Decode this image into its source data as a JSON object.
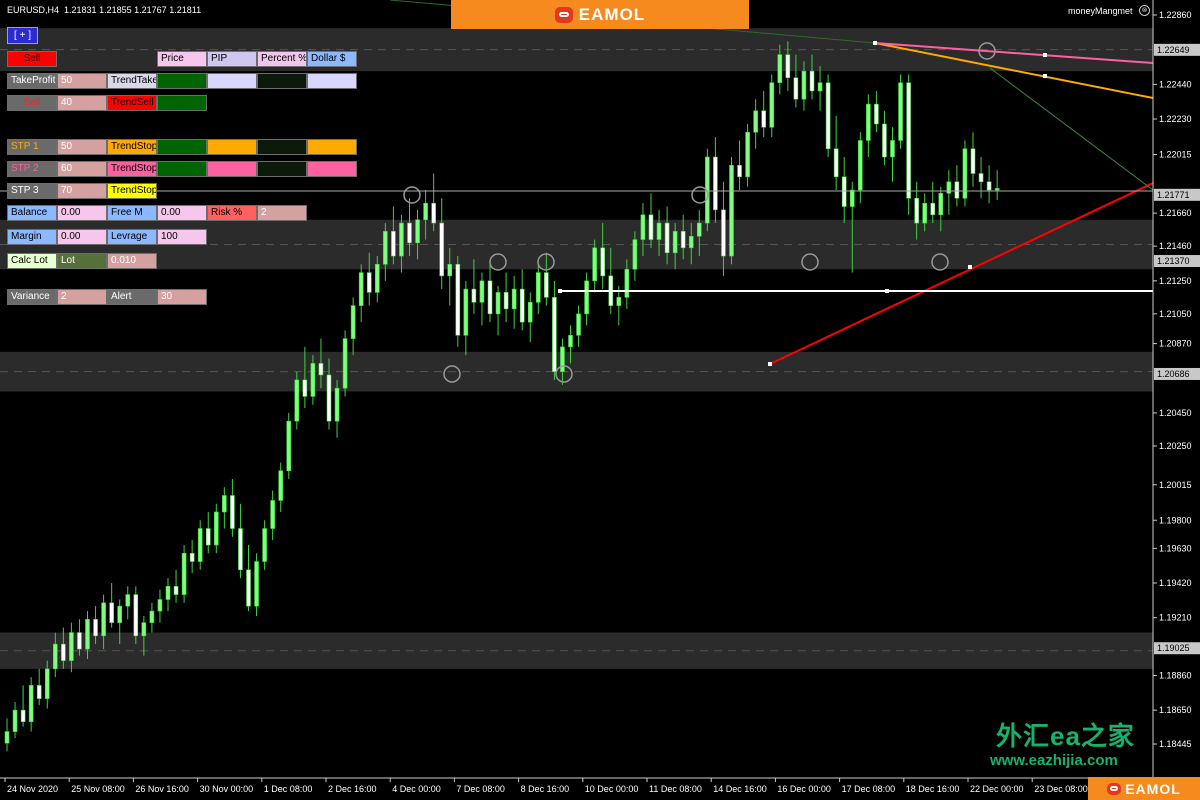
{
  "symbol_header": {
    "symbol": "EURUSD,H4",
    "open": "1.21831",
    "high": "1.21855",
    "low": "1.21767",
    "close": "1.21811"
  },
  "toggle_button": "[ + ]",
  "brand": {
    "name": "EAMOL"
  },
  "indicator_title": "moneyMangmet",
  "indicator_close": "⊗",
  "panel": {
    "r1": {
      "sell": "Sell",
      "price": "Price",
      "pip": "PIP",
      "percent": "Percent %",
      "dollar": "Dollar $"
    },
    "r2": {
      "label": "TakeProfit",
      "value": "50",
      "trend": "TrendTake"
    },
    "r3": {
      "label": "Sell",
      "value": "40",
      "trend": "TrendSell"
    },
    "r4": {
      "label": "STP 1",
      "value": "50",
      "trend": "TrendStop"
    },
    "r5": {
      "label": "STP 2",
      "value": "60",
      "trend": "TrendStop"
    },
    "r6": {
      "label": "STP 3",
      "value": "70",
      "trend": "TrendStop"
    },
    "r7": {
      "balance": "Balance",
      "balance_val": "0.00",
      "free": "Free M",
      "free_val": "0.00",
      "risk": "Risk %",
      "risk_val": "2"
    },
    "r8": {
      "margin": "Margin",
      "margin_val": "0.00",
      "lev": "Levrage",
      "lev_val": "100"
    },
    "r9": {
      "calc": "Calc Lot",
      "lot": "Lot",
      "lot_val": "0.010"
    },
    "r10": {
      "variance": "Variance",
      "variance_val": "2",
      "alert": "Alert",
      "alert_val": "30"
    }
  },
  "watermark": {
    "cn": "外汇ea之家",
    "url": "www.eazhijia.com"
  },
  "colors": {
    "bull": "#7dff7d",
    "bear": "#ffffff",
    "wick": "#3fd23f",
    "sell": "#ff0000",
    "orange": "#ffaa00",
    "pink": "#ff60a0",
    "yellow": "#ffff00",
    "green": "#006400"
  },
  "chart_data": {
    "type": "candlestick",
    "price_axis": [
      "1.22860",
      "1.22440",
      "1.22230",
      "1.22015",
      "1.21660",
      "1.21460",
      "1.21250",
      "1.21050",
      "1.20870",
      "1.20450",
      "1.20250",
      "1.20015",
      "1.19800",
      "1.19630",
      "1.19420",
      "1.19210",
      "1.18860",
      "1.18650",
      "1.18445"
    ],
    "price_tags": [
      "1.22649",
      "1.21771",
      "1.21370",
      "1.20686",
      "1.19025"
    ],
    "time_axis": [
      "24 Nov 2020",
      "25 Nov 08:00",
      "26 Nov 16:00",
      "30 Nov 00:00",
      "1 Dec 08:00",
      "2 Dec 16:00",
      "4 Dec 00:00",
      "7 Dec 08:00",
      "8 Dec 16:00",
      "10 Dec 00:00",
      "11 Dec 08:00",
      "14 Dec 16:00",
      "16 Dec 00:00",
      "17 Dec 08:00",
      "18 Dec 16:00",
      "22 Dec 00:00",
      "23 Dec 08:00"
    ],
    "ohlc": [
      [
        1.1845,
        1.186,
        1.184,
        1.1852
      ],
      [
        1.1852,
        1.187,
        1.1848,
        1.1865
      ],
      [
        1.1865,
        1.188,
        1.1855,
        1.1858
      ],
      [
        1.1858,
        1.1885,
        1.1852,
        1.188
      ],
      [
        1.188,
        1.189,
        1.1868,
        1.1872
      ],
      [
        1.1872,
        1.1895,
        1.1866,
        1.189
      ],
      [
        1.189,
        1.1912,
        1.1885,
        1.1905
      ],
      [
        1.1905,
        1.1915,
        1.189,
        1.1895
      ],
      [
        1.1895,
        1.1918,
        1.1888,
        1.1912
      ],
      [
        1.1912,
        1.192,
        1.1898,
        1.1902
      ],
      [
        1.1902,
        1.1925,
        1.1896,
        1.192
      ],
      [
        1.192,
        1.1928,
        1.1905,
        1.191
      ],
      [
        1.191,
        1.1935,
        1.1902,
        1.193
      ],
      [
        1.193,
        1.1942,
        1.1915,
        1.1918
      ],
      [
        1.1918,
        1.1932,
        1.1905,
        1.1928
      ],
      [
        1.1928,
        1.194,
        1.192,
        1.1935
      ],
      [
        1.1935,
        1.194,
        1.1905,
        1.191
      ],
      [
        1.191,
        1.1922,
        1.1898,
        1.1918
      ],
      [
        1.1918,
        1.193,
        1.1912,
        1.1925
      ],
      [
        1.1925,
        1.1938,
        1.1918,
        1.1932
      ],
      [
        1.1932,
        1.1945,
        1.1925,
        1.194
      ],
      [
        1.194,
        1.195,
        1.193,
        1.1935
      ],
      [
        1.1935,
        1.1965,
        1.193,
        1.196
      ],
      [
        1.196,
        1.1968,
        1.1948,
        1.1955
      ],
      [
        1.1955,
        1.198,
        1.195,
        1.1975
      ],
      [
        1.1975,
        1.1985,
        1.196,
        1.1965
      ],
      [
        1.1965,
        1.199,
        1.196,
        1.1985
      ],
      [
        1.1985,
        1.2,
        1.1975,
        1.1995
      ],
      [
        1.1995,
        1.2005,
        1.197,
        1.1975
      ],
      [
        1.1975,
        1.199,
        1.1945,
        1.195
      ],
      [
        1.195,
        1.1965,
        1.1925,
        1.1928
      ],
      [
        1.1928,
        1.196,
        1.1922,
        1.1955
      ],
      [
        1.1955,
        1.198,
        1.195,
        1.1975
      ],
      [
        1.1975,
        1.1998,
        1.1968,
        1.1992
      ],
      [
        1.1992,
        1.2015,
        1.1985,
        1.201
      ],
      [
        1.201,
        1.2045,
        1.2005,
        1.204
      ],
      [
        1.204,
        1.207,
        1.2035,
        1.2065
      ],
      [
        1.2065,
        1.2085,
        1.2048,
        1.2055
      ],
      [
        1.2055,
        1.208,
        1.205,
        1.2075
      ],
      [
        1.2075,
        1.209,
        1.206,
        1.2068
      ],
      [
        1.2068,
        1.2078,
        1.2035,
        1.204
      ],
      [
        1.204,
        1.2065,
        1.203,
        1.206
      ],
      [
        1.206,
        1.2095,
        1.2055,
        1.209
      ],
      [
        1.209,
        1.2115,
        1.208,
        1.211
      ],
      [
        1.211,
        1.2135,
        1.21,
        1.213
      ],
      [
        1.213,
        1.2142,
        1.211,
        1.2118
      ],
      [
        1.2118,
        1.214,
        1.2112,
        1.2135
      ],
      [
        1.2135,
        1.216,
        1.2125,
        1.2155
      ],
      [
        1.2155,
        1.217,
        1.2135,
        1.214
      ],
      [
        1.214,
        1.2165,
        1.213,
        1.216
      ],
      [
        1.216,
        1.2175,
        1.214,
        1.2148
      ],
      [
        1.2148,
        1.2168,
        1.2138,
        1.2162
      ],
      [
        1.2162,
        1.218,
        1.215,
        1.2172
      ],
      [
        1.2172,
        1.219,
        1.2155,
        1.216
      ],
      [
        1.216,
        1.2175,
        1.212,
        1.2128
      ],
      [
        1.2128,
        1.2145,
        1.211,
        1.2135
      ],
      [
        1.2135,
        1.214,
        1.2085,
        1.2092
      ],
      [
        1.2092,
        1.2125,
        1.208,
        1.212
      ],
      [
        1.212,
        1.2138,
        1.2105,
        1.2112
      ],
      [
        1.2112,
        1.213,
        1.2098,
        1.2125
      ],
      [
        1.2125,
        1.2135,
        1.21,
        1.2105
      ],
      [
        1.2105,
        1.2122,
        1.2092,
        1.2118
      ],
      [
        1.2118,
        1.213,
        1.21,
        1.2108
      ],
      [
        1.2108,
        1.2128,
        1.2096,
        1.212
      ],
      [
        1.212,
        1.2132,
        1.2095,
        1.21
      ],
      [
        1.21,
        1.2118,
        1.2088,
        1.2112
      ],
      [
        1.2112,
        1.2135,
        1.2105,
        1.213
      ],
      [
        1.213,
        1.2142,
        1.211,
        1.2115
      ],
      [
        1.2115,
        1.2125,
        1.2065,
        1.207
      ],
      [
        1.207,
        1.209,
        1.2062,
        1.2085
      ],
      [
        1.2085,
        1.2098,
        1.2075,
        1.2092
      ],
      [
        1.2092,
        1.211,
        1.2085,
        1.2105
      ],
      [
        1.2105,
        1.213,
        1.2098,
        1.2125
      ],
      [
        1.2125,
        1.215,
        1.2118,
        1.2145
      ],
      [
        1.2145,
        1.216,
        1.212,
        1.2128
      ],
      [
        1.2128,
        1.2145,
        1.2105,
        1.211
      ],
      [
        1.211,
        1.2122,
        1.2098,
        1.2115
      ],
      [
        1.2115,
        1.2138,
        1.2108,
        1.2132
      ],
      [
        1.2132,
        1.2155,
        1.2125,
        1.215
      ],
      [
        1.215,
        1.2172,
        1.214,
        1.2165
      ],
      [
        1.2165,
        1.2178,
        1.2145,
        1.215
      ],
      [
        1.215,
        1.2168,
        1.214,
        1.216
      ],
      [
        1.216,
        1.217,
        1.2135,
        1.2142
      ],
      [
        1.2142,
        1.216,
        1.2132,
        1.2155
      ],
      [
        1.2155,
        1.2165,
        1.2138,
        1.2145
      ],
      [
        1.2145,
        1.216,
        1.2135,
        1.2152
      ],
      [
        1.2152,
        1.2168,
        1.214,
        1.216
      ],
      [
        1.216,
        1.2205,
        1.2155,
        1.22
      ],
      [
        1.22,
        1.2212,
        1.216,
        1.2168
      ],
      [
        1.2168,
        1.2185,
        1.2128,
        1.214
      ],
      [
        1.214,
        1.22,
        1.2135,
        1.2195
      ],
      [
        1.2195,
        1.221,
        1.218,
        1.2188
      ],
      [
        1.2188,
        1.222,
        1.2182,
        1.2215
      ],
      [
        1.2215,
        1.2235,
        1.2205,
        1.2228
      ],
      [
        1.2228,
        1.224,
        1.2212,
        1.2218
      ],
      [
        1.2218,
        1.225,
        1.2212,
        1.2245
      ],
      [
        1.2245,
        1.2268,
        1.2238,
        1.2262
      ],
      [
        1.2262,
        1.227,
        1.224,
        1.2248
      ],
      [
        1.2248,
        1.2262,
        1.223,
        1.2235
      ],
      [
        1.2235,
        1.2258,
        1.2228,
        1.2252
      ],
      [
        1.2252,
        1.2262,
        1.2235,
        1.224
      ],
      [
        1.224,
        1.2255,
        1.2228,
        1.2245
      ],
      [
        1.2245,
        1.225,
        1.22,
        1.2205
      ],
      [
        1.2205,
        1.2225,
        1.218,
        1.2188
      ],
      [
        1.2188,
        1.22,
        1.216,
        1.217
      ],
      [
        1.217,
        1.2185,
        1.213,
        1.218
      ],
      [
        1.218,
        1.2215,
        1.2172,
        1.221
      ],
      [
        1.221,
        1.2238,
        1.22,
        1.2232
      ],
      [
        1.2232,
        1.224,
        1.2215,
        1.222
      ],
      [
        1.222,
        1.2228,
        1.2195,
        1.22
      ],
      [
        1.22,
        1.2218,
        1.2185,
        1.221
      ],
      [
        1.221,
        1.225,
        1.2205,
        1.2245
      ],
      [
        1.2245,
        1.225,
        1.2165,
        1.2175
      ],
      [
        1.2175,
        1.2185,
        1.215,
        1.216
      ],
      [
        1.216,
        1.2178,
        1.2155,
        1.2172
      ],
      [
        1.2172,
        1.2185,
        1.216,
        1.2165
      ],
      [
        1.2165,
        1.2182,
        1.2155,
        1.2178
      ],
      [
        1.2178,
        1.2192,
        1.2165,
        1.2185
      ],
      [
        1.2185,
        1.2195,
        1.217,
        1.2175
      ],
      [
        1.2175,
        1.221,
        1.217,
        1.2205
      ],
      [
        1.2205,
        1.2215,
        1.2182,
        1.219
      ],
      [
        1.219,
        1.22,
        1.2175,
        1.2185
      ],
      [
        1.2185,
        1.2195,
        1.2172,
        1.218
      ],
      [
        1.218,
        1.2192,
        1.2174,
        1.2181
      ]
    ]
  }
}
